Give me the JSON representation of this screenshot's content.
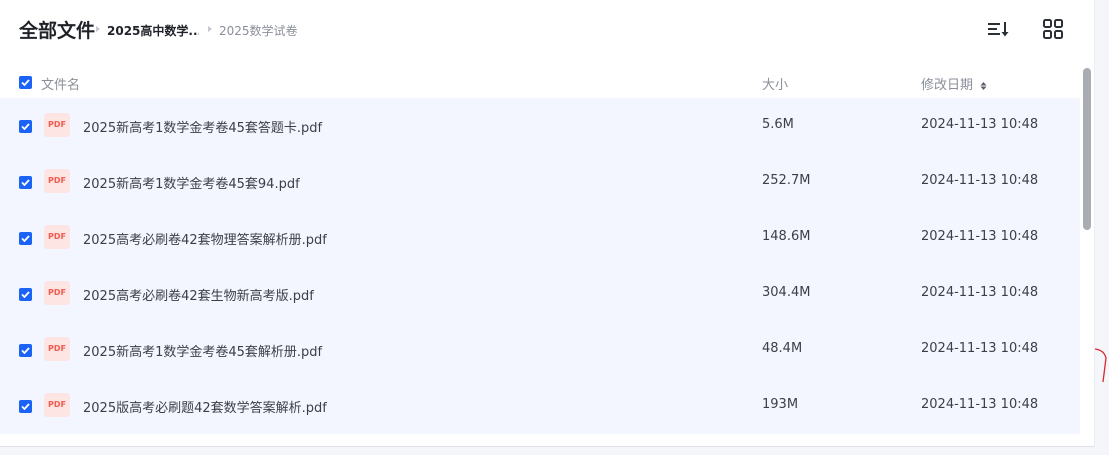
{
  "breadcrumb": {
    "root": "全部文件",
    "items": [
      "2025高中数学...",
      "2025数学试卷"
    ]
  },
  "toolbar": {
    "sort_icon": "sort-list-icon",
    "grid_icon": "grid-view-icon"
  },
  "table": {
    "headers": {
      "name": "文件名",
      "size": "大小",
      "date": "修改日期"
    },
    "rows": [
      {
        "name": "2025新高考1数学金考卷45套答题卡.pdf",
        "size": "5.6M",
        "date": "2024-11-13 10:48",
        "type": "PDF"
      },
      {
        "name": "2025新高考1数学金考卷45套94.pdf",
        "size": "252.7M",
        "date": "2024-11-13 10:48",
        "type": "PDF"
      },
      {
        "name": "2025高考必刷卷42套物理答案解析册.pdf",
        "size": "148.6M",
        "date": "2024-11-13 10:48",
        "type": "PDF"
      },
      {
        "name": "2025高考必刷卷42套生物新高考版.pdf",
        "size": "304.4M",
        "date": "2024-11-13 10:48",
        "type": "PDF"
      },
      {
        "name": "2025新高考1数学金考卷45套解析册.pdf",
        "size": "48.4M",
        "date": "2024-11-13 10:48",
        "type": "PDF"
      },
      {
        "name": "2025版高考必刷题42套数学答案解析.pdf",
        "size": "193M",
        "date": "2024-11-13 10:48",
        "type": "PDF"
      }
    ]
  },
  "colors": {
    "accent": "#1a63f6",
    "row_selected_bg": "#f4f6ff",
    "pdf_red": "#f05b4f"
  }
}
